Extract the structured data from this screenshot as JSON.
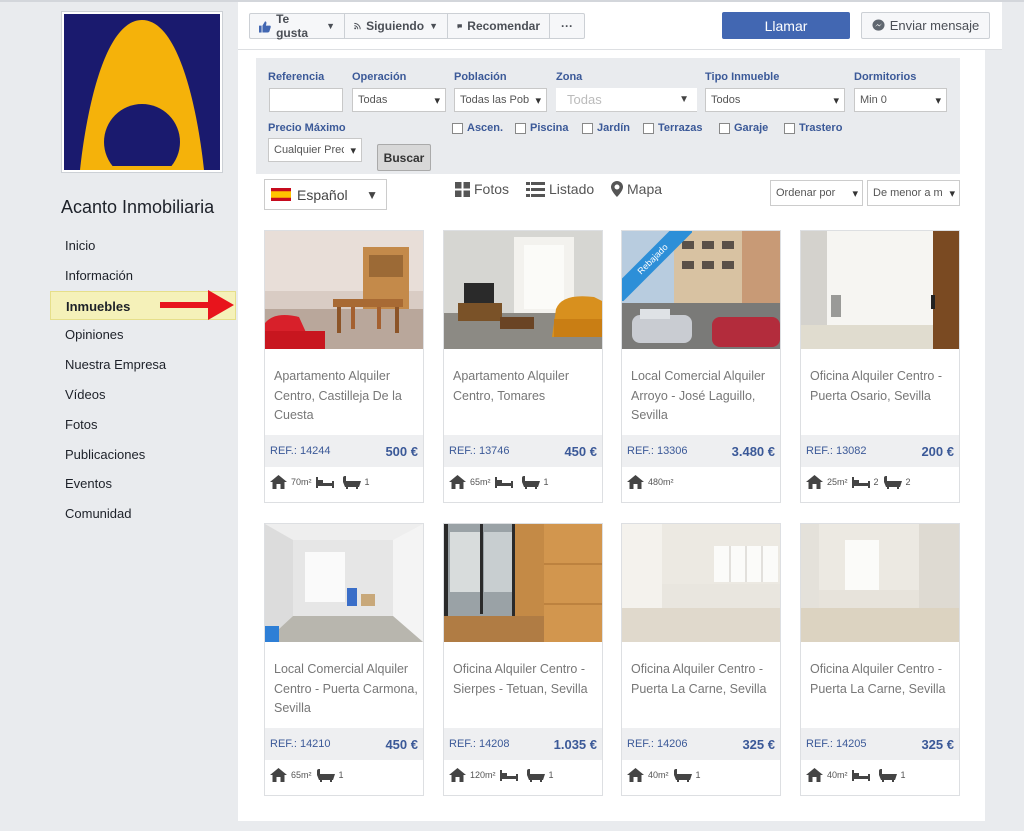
{
  "page": {
    "name": "Acanto Inmobiliaria"
  },
  "nav": [
    {
      "label": "Inicio",
      "active": false
    },
    {
      "label": "Información",
      "active": false
    },
    {
      "label": "Inmuebles",
      "active": true
    },
    {
      "label": "Opiniones",
      "active": false
    },
    {
      "label": "Nuestra Empresa",
      "active": false
    },
    {
      "label": "Vídeos",
      "active": false
    },
    {
      "label": "Fotos",
      "active": false
    },
    {
      "label": "Publicaciones",
      "active": false
    },
    {
      "label": "Eventos",
      "active": false
    },
    {
      "label": "Comunidad",
      "active": false
    }
  ],
  "actions": {
    "like": "Te gusta",
    "follow": "Siguiendo",
    "recommend": "Recomendar",
    "more": "···",
    "call": "Llamar",
    "message": "Enviar mensaje"
  },
  "filters": {
    "referencia_label": "Referencia",
    "referencia_value": "",
    "operacion_label": "Operación",
    "operacion_value": "Todas",
    "poblacion_label": "Población",
    "poblacion_value": "Todas las Pob",
    "zona_label": "Zona",
    "zona_value": "Todas",
    "tipo_label": "Tipo Inmueble",
    "tipo_value": "Todos",
    "dormitorios_label": "Dormitorios",
    "dormitorios_value": "Min 0",
    "precio_label": "Precio Máximo",
    "precio_value": "Cualquier Prec",
    "checkboxes": [
      "Ascen.",
      "Piscina",
      "Jardín",
      "Terrazas",
      "Garaje",
      "Trastero"
    ],
    "search_button": "Buscar"
  },
  "toolbar": {
    "language": "Español",
    "view_fotos": "Fotos",
    "view_listado": "Listado",
    "view_mapa": "Mapa",
    "sort_by": "Ordenar por",
    "sort_order": "De menor a m"
  },
  "listings": [
    {
      "title": "Apartamento Alquiler Centro, Castilleja De la Cuesta",
      "ref": "REF.: 14244",
      "price": "500 €",
      "area": "70m²",
      "beds": "",
      "baths": "1",
      "badge": "",
      "photo": "living-room"
    },
    {
      "title": "Apartamento Alquiler Centro, Tomares",
      "ref": "REF.: 13746",
      "price": "450 €",
      "area": "65m²",
      "beds": "",
      "baths": "1",
      "badge": "",
      "photo": "sofa-room"
    },
    {
      "title": "Local Comercial Alquiler Arroyo - José Laguillo, Sevilla",
      "ref": "REF.: 13306",
      "price": "3.480 €",
      "area": "480m²",
      "beds": null,
      "baths": null,
      "badge": "Rebajado",
      "photo": "street"
    },
    {
      "title": "Oficina Alquiler Centro - Puerta Osario, Sevilla",
      "ref": "REF.: 13082",
      "price": "200 €",
      "area": "25m²",
      "beds": "2",
      "baths": "2",
      "badge": "",
      "photo": "office-door"
    },
    {
      "title": "Local Comercial Alquiler Centro - Puerta Carmona, Sevilla",
      "ref": "REF.: 14210",
      "price": "450 €",
      "area": "65m²",
      "beds": null,
      "baths": "1",
      "badge": "",
      "photo": "empty-local"
    },
    {
      "title": "Oficina Alquiler Centro - Sierpes - Tetuan, Sevilla",
      "ref": "REF.: 14208",
      "price": "1.035 €",
      "area": "120m²",
      "beds": "",
      "baths": "1",
      "badge": "",
      "photo": "wood-office"
    },
    {
      "title": "Oficina Alquiler Centro - Puerta La Carne, Sevilla",
      "ref": "REF.: 14206",
      "price": "325 €",
      "area": "40m²",
      "beds": null,
      "baths": "1",
      "badge": "",
      "photo": "bright-room"
    },
    {
      "title": "Oficina Alquiler Centro - Puerta La Carne, Sevilla",
      "ref": "REF.: 14205",
      "price": "325 €",
      "area": "40m²",
      "beds": "",
      "baths": "1",
      "badge": "",
      "photo": "bright-room-2"
    }
  ],
  "colors": {
    "brand_blue": "#3b5998",
    "button_blue": "#4267b2",
    "logo_navy": "#1a1a6e",
    "logo_yellow": "#f5b20a",
    "highlight": "#f5f1b9",
    "arrow_red": "#e8141c"
  }
}
